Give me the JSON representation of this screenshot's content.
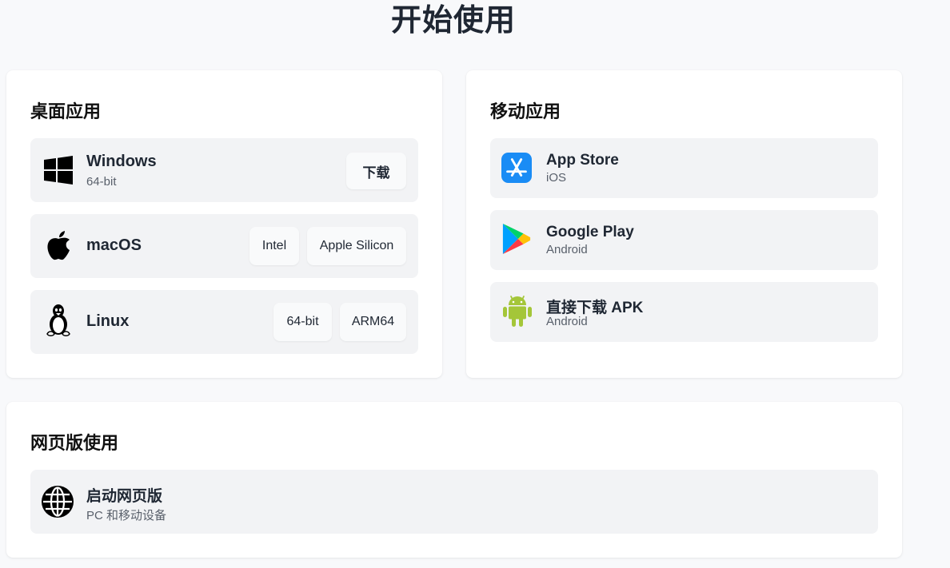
{
  "page": {
    "title": "开始使用"
  },
  "desktop": {
    "heading": "桌面应用",
    "windows": {
      "name": "Windows",
      "sub": "64-bit",
      "button": "下载"
    },
    "macos": {
      "name": "macOS",
      "buttons": [
        "Intel",
        "Apple Silicon"
      ]
    },
    "linux": {
      "name": "Linux",
      "buttons": [
        "64-bit",
        "ARM64"
      ]
    }
  },
  "mobile": {
    "heading": "移动应用",
    "items": [
      {
        "name": "App Store",
        "sub": "iOS",
        "icon": "app-store-icon"
      },
      {
        "name": "Google Play",
        "sub": "Android",
        "icon": "google-play-icon"
      },
      {
        "name": "直接下载 APK",
        "sub": "Android",
        "icon": "android-icon"
      }
    ]
  },
  "web": {
    "heading": "网页版使用",
    "launch": {
      "name": "启动网页版",
      "sub": "PC 和移动设备",
      "icon": "globe-icon"
    }
  },
  "colors": {
    "background": "#f8f9fb",
    "card": "#ffffff",
    "row": "#f2f3f5",
    "android_green": "#a4c639",
    "app_store_blue": "#1a8cf5"
  }
}
